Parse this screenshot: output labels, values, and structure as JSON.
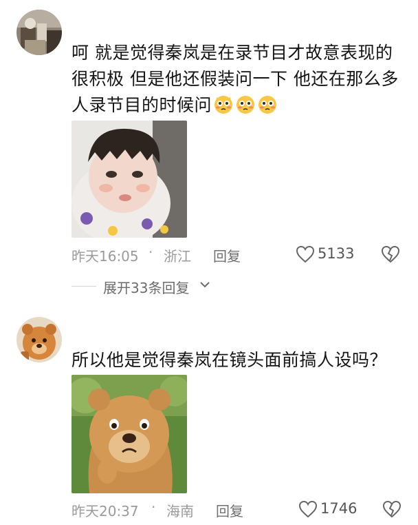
{
  "comments": [
    {
      "text": "呵 就是觉得秦岚是在录节目才故意表现的很积极 但是他还假装问一下 他还在那么多人录节目的时候问",
      "emojis": [
        "flushed-face-icon",
        "flushed-face-icon",
        "flushed-face-icon"
      ],
      "image": "crying-baby-photo",
      "time": "昨天16:05",
      "dot": "·",
      "location": "浙江",
      "reply_label": "回复",
      "likes": "5133",
      "expand_label": "展开33条回复"
    },
    {
      "text": "所以他是觉得秦岚在镜头面前搞人设吗？",
      "image": "cartoon-bear-sticker",
      "time": "昨天20:37",
      "dot": "·",
      "location": "海南",
      "reply_label": "回复",
      "likes": "1746"
    }
  ],
  "colors": {
    "text": "#151515",
    "meta": "#9a9a9a",
    "reply": "#6f6f6f",
    "emoji_yellow": "#f7c843"
  }
}
